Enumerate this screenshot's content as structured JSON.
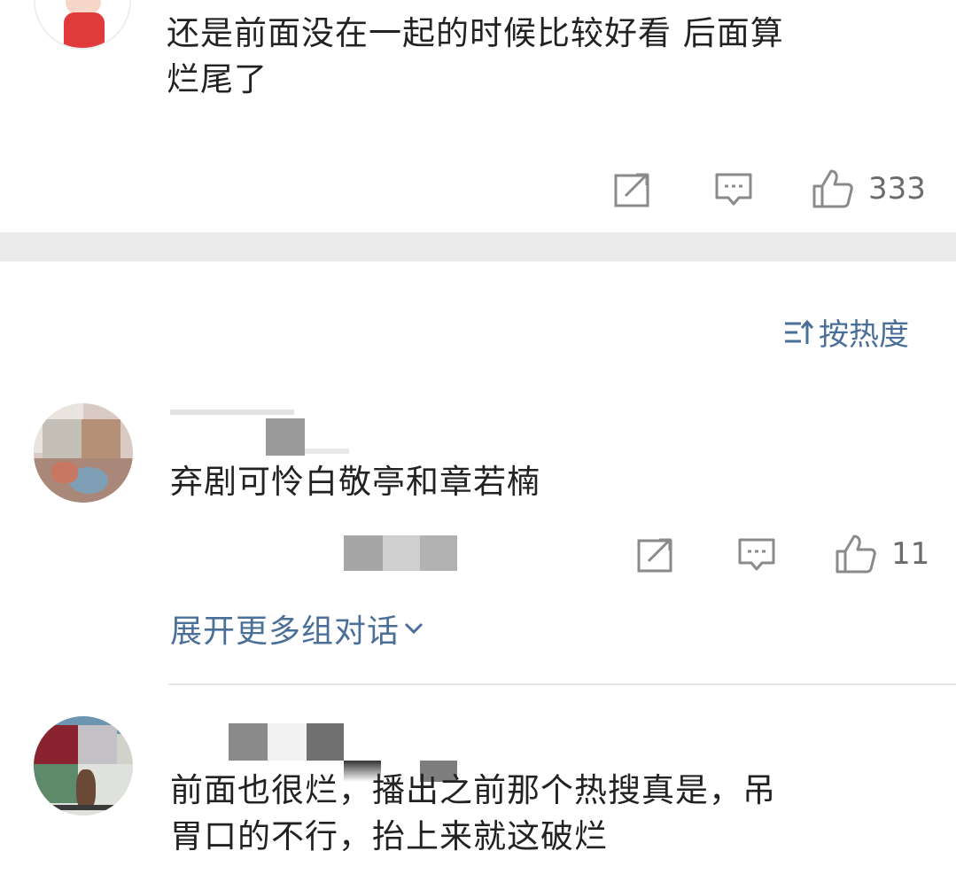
{
  "comments": [
    {
      "text": "还是前面没在一起的时候比较好看 后面算烂尾了",
      "line1": "还是前面没在一起的时候比较好看 后面算",
      "line2": "烂尾了",
      "like_count": "333"
    },
    {
      "text": "弃剧可怜白敬亭和章若楠",
      "like_count": "11"
    },
    {
      "text": "前面也很烂，播出之前那个热搜真是，吊胃口的不行，抬上来就这破烂",
      "line1": "前面也很烂，播出之前那个热搜真是，吊",
      "line2": "胃口的不行，抬上来就这破烂"
    }
  ],
  "sort": {
    "label": "按热度",
    "icon": "sort-icon"
  },
  "expand": {
    "label": "展开更多组对话",
    "icon": "chevron-down-icon"
  },
  "icons": [
    "share-icon",
    "reply-icon",
    "like-icon"
  ],
  "colors": {
    "link": "#4a6f98",
    "text": "#222222",
    "meta": "#6b6b6b",
    "band": "#ebebeb"
  }
}
